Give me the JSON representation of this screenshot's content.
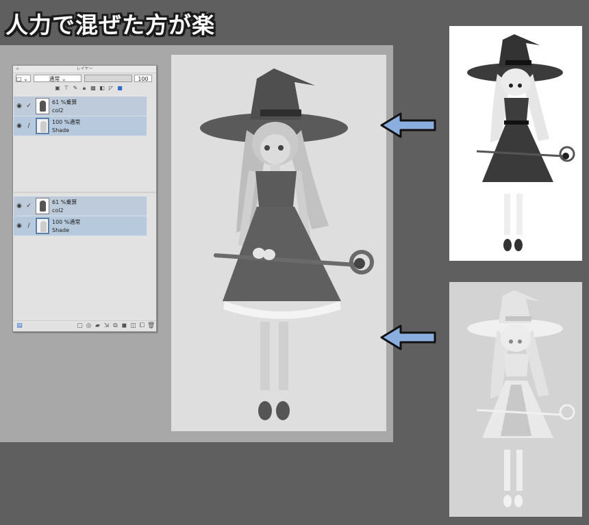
{
  "title": "人力で混ぜた方が楽",
  "layer_panel": {
    "title": "レイヤー",
    "blend_mode": "通常",
    "opacity": "100",
    "groups": [
      {
        "layers": [
          {
            "mode": "61 %乗算",
            "name": "col2",
            "type": "color"
          },
          {
            "mode": "100 %通常",
            "name": "Shade",
            "type": "shade"
          }
        ]
      },
      {
        "layers": [
          {
            "mode": "61 %乗算",
            "name": "col2",
            "type": "color"
          },
          {
            "mode": "100 %通常",
            "name": "Shade",
            "type": "shade"
          }
        ]
      }
    ]
  },
  "colors": {
    "arrow_fill": "#8aaee0",
    "arrow_outline": "#111111",
    "selected_layer": "#b7c9dd"
  }
}
